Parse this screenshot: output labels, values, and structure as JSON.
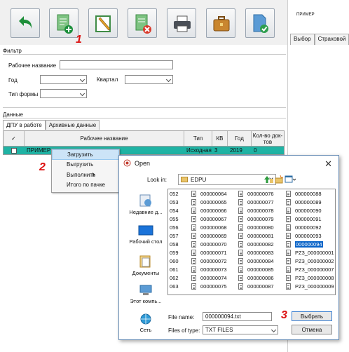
{
  "annotations": {
    "one": "1",
    "two": "2",
    "three": "3"
  },
  "right_panel": {
    "title": "ПРИМЕР",
    "tabs": [
      "Выбор",
      "Страховой"
    ]
  },
  "filter": {
    "title": "Фильтр",
    "work_name_label": "Рабочее название",
    "year_label": "Год",
    "quarter_label": "Квартал",
    "form_type_label": "Тип формы"
  },
  "data_section": {
    "title": "Данные",
    "tabs": [
      "ДПУ в работе",
      "Архивные данные"
    ],
    "columns": [
      "✓",
      "Рабочее название",
      "Тип",
      "КВ",
      "Год",
      "Кол-во док-тов"
    ],
    "rows": [
      {
        "name": "ПРИМЕР",
        "type": "Исходная",
        "kv": "3",
        "year": "2019",
        "count": "0"
      }
    ]
  },
  "context_menu": {
    "items": [
      "Загрузить",
      "Выгрузить",
      "Выполнить",
      "Итого по пачке"
    ]
  },
  "open_dialog": {
    "title": "Open",
    "look_in_label": "Look in:",
    "look_in_value": "EDPU",
    "places": [
      "Недавние д...",
      "Рабочий стол",
      "Документы",
      "Этот компь...",
      "Сеть"
    ],
    "columns": [
      [
        "052",
        "053",
        "054",
        "055",
        "056",
        "057",
        "058",
        "059",
        "060",
        "061",
        "062",
        "063"
      ],
      [
        "000000064",
        "000000065",
        "000000066",
        "000000067",
        "000000068",
        "000000069",
        "000000070",
        "000000071",
        "000000072",
        "000000073",
        "000000074",
        "000000075"
      ],
      [
        "000000076",
        "000000077",
        "000000078",
        "000000079",
        "000000080",
        "000000081",
        "000000082",
        "000000083",
        "000000084",
        "000000085",
        "000000086",
        "000000087"
      ],
      [
        "000000088",
        "000000089",
        "000000090",
        "000000091",
        "000000092",
        "000000093",
        "000000094",
        "PZ3_000000001",
        "PZ3_000000002",
        "PZ3_000000007",
        "PZ3_000000008",
        "PZ3_000000009"
      ]
    ],
    "selected_file": "000000094",
    "file_name_label": "File name:",
    "file_name_value": "000000094.txt",
    "file_type_label": "Files of type:",
    "file_type_value": "TXT FILES",
    "open_button": "Выбрать",
    "cancel_button": "Отмена"
  },
  "colors": {
    "selected_row": "#1fb3a4",
    "annotation": "#dd1111",
    "selection": "#0a64c8"
  }
}
